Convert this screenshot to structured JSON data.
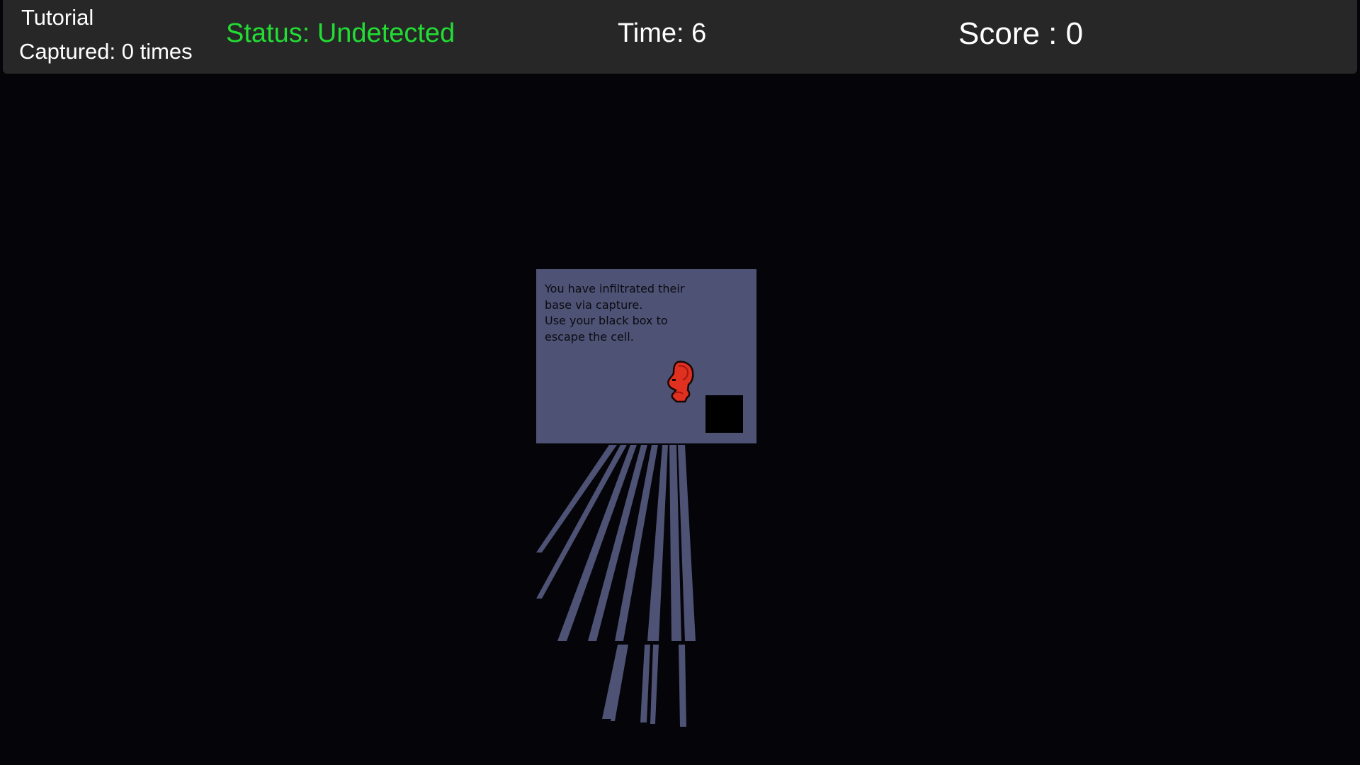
{
  "hud": {
    "level_name": "Tutorial",
    "captured_text": "Captured: 0 times",
    "status_text": "Status: Undetected",
    "time_text": "Time: 6",
    "score_text": "Score : 0"
  },
  "tutorial": {
    "message": "You have infiltrated their\nbase via capture.\nUse your black box to\nescape the cell."
  },
  "colors": {
    "hud_bg": "#272727",
    "status_color": "#22dd33",
    "room_floor": "#4e5274",
    "player_red": "#e03020",
    "background": "#040409"
  },
  "icons": {
    "player": "red-hooded-spy-sprite",
    "black_box": "black-square"
  }
}
